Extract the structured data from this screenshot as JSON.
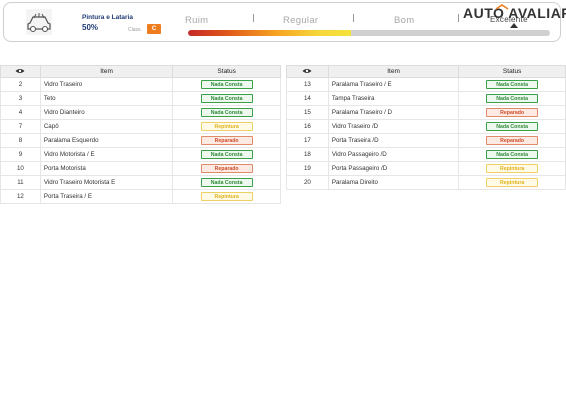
{
  "header": {
    "category_title": "Pintura e Lataria",
    "percentage": "50%",
    "class_label": "Class.",
    "class_value": "C",
    "scale": [
      "Ruim",
      "Regular",
      "Bom",
      "Excelente"
    ],
    "score_fraction": 0.45,
    "brand": "AUTO AVALIAR"
  },
  "table": {
    "headers": {
      "item": "Item",
      "status": "Status"
    },
    "left_rows": [
      {
        "num": "2",
        "name": "Vidro Traseiro",
        "status": "Nada Consta",
        "kind": "nada"
      },
      {
        "num": "3",
        "name": "Teto",
        "status": "Nada Consta",
        "kind": "nada"
      },
      {
        "num": "4",
        "name": "Vidro Dianteiro",
        "status": "Nada Consta",
        "kind": "nada"
      },
      {
        "num": "7",
        "name": "Capô",
        "status": "Repintura",
        "kind": "repi"
      },
      {
        "num": "8",
        "name": "Paralama Esquerdo",
        "status": "Reparado",
        "kind": "rep"
      },
      {
        "num": "9",
        "name": "Vidro Motorista / E",
        "status": "Nada Consta",
        "kind": "nada"
      },
      {
        "num": "10",
        "name": "Porta Motorista",
        "status": "Reparado",
        "kind": "rep"
      },
      {
        "num": "11",
        "name": "Vidro Traseiro Motorista E",
        "status": "Nada Consta",
        "kind": "nada"
      },
      {
        "num": "12",
        "name": "Porta Traseira / E",
        "status": "Repintura",
        "kind": "repi"
      }
    ],
    "right_rows": [
      {
        "num": "13",
        "name": "Paralama Traseiro / E",
        "status": "Nada Consta",
        "kind": "nada"
      },
      {
        "num": "14",
        "name": "Tampa Traseira",
        "status": "Nada Consta",
        "kind": "nada"
      },
      {
        "num": "15",
        "name": "Paralama Traseiro / D",
        "status": "Reparado",
        "kind": "rep"
      },
      {
        "num": "16",
        "name": "Vidro Traseiro /D",
        "status": "Nada Consta",
        "kind": "nada"
      },
      {
        "num": "17",
        "name": "Porta Traseira /D",
        "status": "Reparado",
        "kind": "rep"
      },
      {
        "num": "18",
        "name": "Vidro Passageiro /D",
        "status": "Nada Consta",
        "kind": "nada"
      },
      {
        "num": "19",
        "name": "Porta Passageiro /D",
        "status": "Repintura",
        "kind": "repi"
      },
      {
        "num": "20",
        "name": "Paralama Direito",
        "status": "Repintura",
        "kind": "repi"
      }
    ]
  },
  "colors": {
    "accent": "#ee7d1f",
    "nada": "#2e8b3a",
    "reparado": "#d04b2a",
    "repintura": "#e0b21a"
  }
}
